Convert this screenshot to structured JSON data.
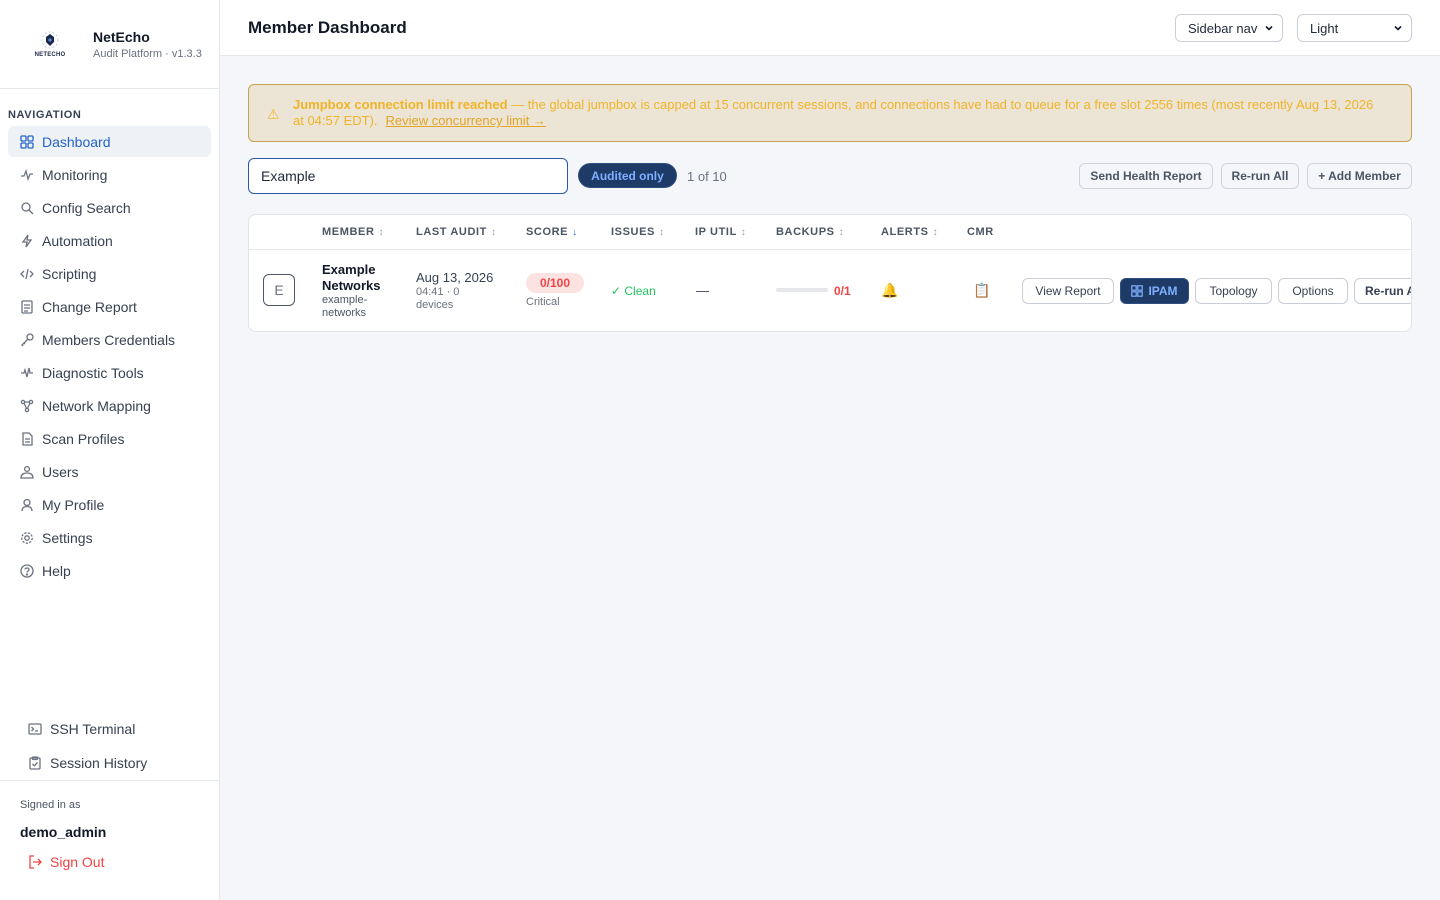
{
  "brand": {
    "name": "NetEcho",
    "subtitle": "Audit Platform · v1.3.3",
    "logo_text": "NETECHO"
  },
  "sidebar": {
    "heading": "NAVIGATION",
    "items": [
      {
        "label": "Dashboard",
        "icon": "grid-icon",
        "active": true
      },
      {
        "label": "Monitoring",
        "icon": "activity-icon"
      },
      {
        "label": "Config Search",
        "icon": "search-icon"
      },
      {
        "label": "Automation",
        "icon": "bolt-icon"
      },
      {
        "label": "Scripting",
        "icon": "code-icon"
      },
      {
        "label": "Change Report",
        "icon": "document-icon"
      },
      {
        "label": "Members Credentials",
        "icon": "key-icon"
      },
      {
        "label": "Diagnostic Tools",
        "icon": "pulse-icon"
      },
      {
        "label": "Network Mapping",
        "icon": "network-icon"
      },
      {
        "label": "Scan Profiles",
        "icon": "file-icon"
      },
      {
        "label": "Users",
        "icon": "users-icon"
      },
      {
        "label": "My Profile",
        "icon": "user-icon"
      },
      {
        "label": "Settings",
        "icon": "gear-icon"
      },
      {
        "label": "Help",
        "icon": "help-icon"
      }
    ],
    "tools": [
      {
        "label": "SSH Terminal",
        "icon": "terminal-icon"
      },
      {
        "label": "Session History",
        "icon": "clipboard-icon"
      }
    ],
    "signed_in_label": "Signed in as",
    "username": "demo_admin",
    "sign_out": "Sign Out"
  },
  "header": {
    "title": "Member Dashboard",
    "nav_mode": "Sidebar nav",
    "theme": "Light"
  },
  "alert": {
    "icon": "warning-icon",
    "title": "Jumpbox connection limit reached",
    "message": " — the global jumpbox is capped at 15 concurrent sessions, and connections have had to queue for a free slot 2556 times (most recently Aug 13, 2026 at 04:57 EDT).",
    "link": "Review concurrency limit →"
  },
  "toolbar": {
    "search_value": "Example",
    "filter_pill": "Audited only",
    "count": "1 of 10",
    "send_health": "Send Health Report",
    "rerun_all": "Re-run All",
    "add_member": "+ Add Member"
  },
  "table": {
    "columns": [
      {
        "label": "MEMBER",
        "sort": "↕"
      },
      {
        "label": "LAST AUDIT",
        "sort": "↕"
      },
      {
        "label": "SCORE",
        "sort": "↓"
      },
      {
        "label": "ISSUES",
        "sort": "↕"
      },
      {
        "label": "IP UTIL",
        "sort": "↕"
      },
      {
        "label": "BACKUPS",
        "sort": "↕"
      },
      {
        "label": "ALERTS",
        "sort": "↕"
      },
      {
        "label": "CMR",
        "sort": ""
      }
    ],
    "rows": [
      {
        "avatar": "E",
        "name": "Example Networks",
        "slug": "example-networks",
        "last_audit_date": "Aug 13, 2026",
        "last_audit_sub": "04:41 · 0 devices",
        "score": "0/100",
        "score_label": "Critical",
        "issues": "✓ Clean",
        "ip_util": "—",
        "backups_value": "0/1",
        "backups_fraction": 0,
        "alerts_icon": "bell-icon",
        "cmr_icon": "clipboard-icon",
        "actions": {
          "view_report": "View Report",
          "ipam": "IPAM",
          "topology": "Topology",
          "options": "Options",
          "rerun": "Re-run A"
        }
      }
    ]
  },
  "colors": {
    "accent": "#2563c9",
    "pill_bg": "#1e3a66",
    "warning": "#f0b429",
    "danger": "#ef4444",
    "success": "#22c55e"
  }
}
